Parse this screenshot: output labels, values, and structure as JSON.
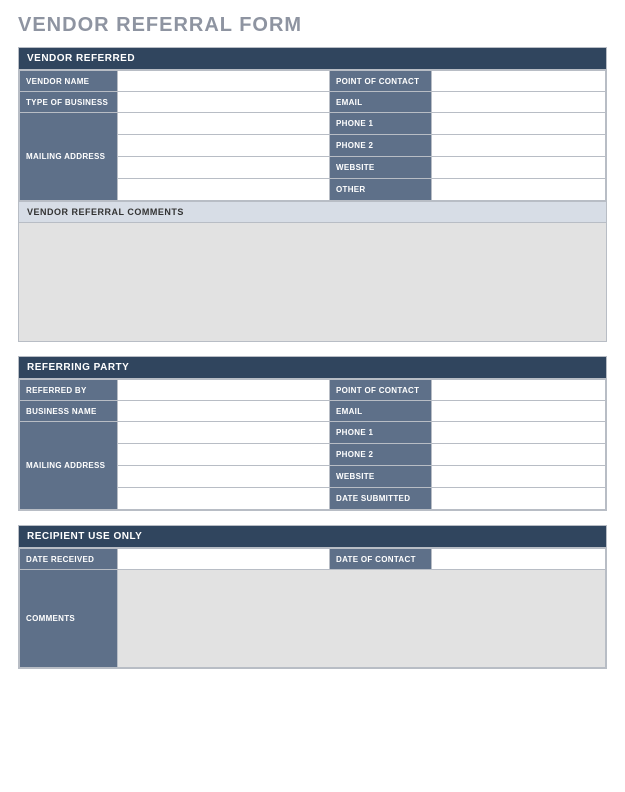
{
  "title": "VENDOR REFERRAL FORM",
  "vendor": {
    "header": "VENDOR REFERRED",
    "labels": {
      "vendor_name": "VENDOR NAME",
      "type_of_business": "TYPE OF BUSINESS",
      "mailing_address": "MAILING ADDRESS",
      "point_of_contact": "POINT OF CONTACT",
      "email": "EMAIL",
      "phone1": "PHONE 1",
      "phone2": "PHONE 2",
      "website": "WEBSITE",
      "other": "OTHER"
    },
    "comments_header": "VENDOR REFERRAL COMMENTS"
  },
  "referring": {
    "header": "REFERRING PARTY",
    "labels": {
      "referred_by": "REFERRED BY",
      "business_name": "BUSINESS NAME",
      "mailing_address": "MAILING ADDRESS",
      "point_of_contact": "POINT OF CONTACT",
      "email": "EMAIL",
      "phone1": "PHONE 1",
      "phone2": "PHONE 2",
      "website": "WEBSITE",
      "date_submitted": "DATE SUBMITTED"
    }
  },
  "recipient": {
    "header": "RECIPIENT USE ONLY",
    "labels": {
      "date_received": "DATE RECEIVED",
      "date_of_contact": "DATE OF CONTACT",
      "comments": "COMMENTS"
    }
  }
}
